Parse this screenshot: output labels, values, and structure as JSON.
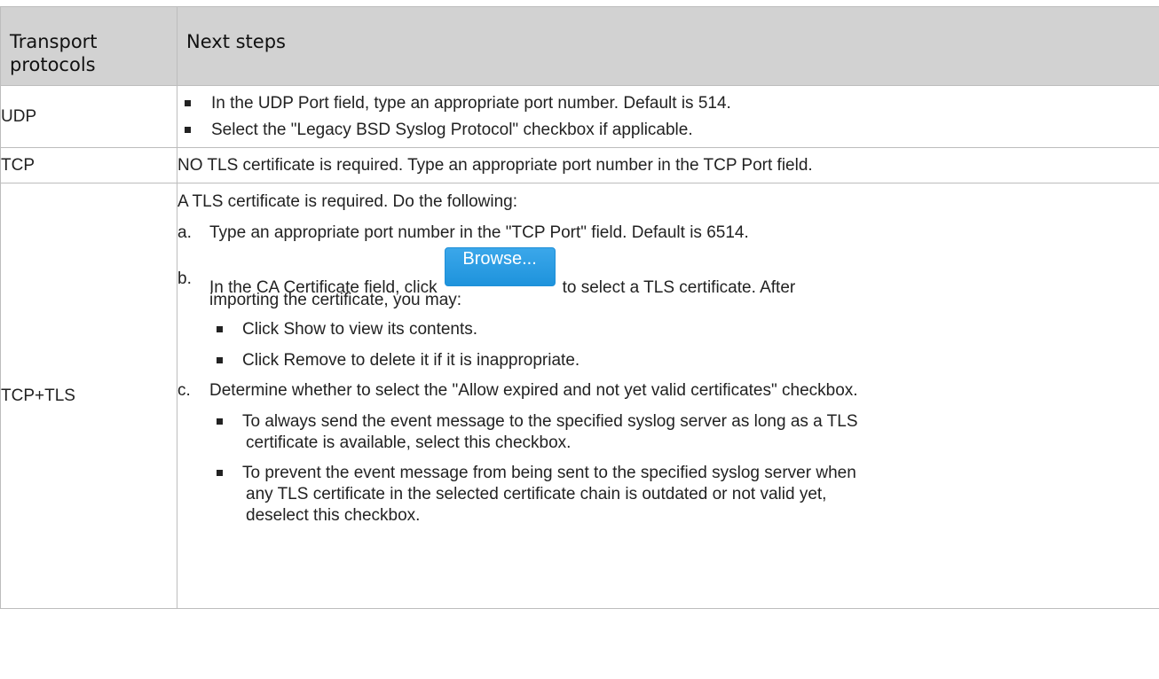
{
  "table": {
    "headers": {
      "col1_line1": "Transport",
      "col1_line2": "protocols",
      "col2": "Next steps"
    },
    "udp": {
      "protocol": "UDP",
      "bullets": [
        "In the UDP Port field, type an appropriate port number. Default is 514.",
        "Select the \"Legacy BSD Syslog Protocol\" checkbox if applicable."
      ]
    },
    "tcp": {
      "protocol": "TCP",
      "text": "NO TLS certificate is required. Type an appropriate port number in the TCP Port field."
    },
    "tcp_tls": {
      "protocol": "TCP+TLS",
      "intro": "A TLS certificate is required. Do the following:",
      "step_a_letter": "a.",
      "step_a": "Type an appropriate port number in the \"TCP Port\" field. Default is 6514.",
      "step_b_letter": "b.",
      "step_b_before": "In the CA Certificate field, click",
      "browse_label": "Browse...",
      "step_b_after": "to select a TLS certificate. After",
      "step_b_line2": "importing the certificate, you may:",
      "step_b_bullets": [
        "Click Show to view its contents.",
        "Click Remove to delete it if it is inappropriate."
      ],
      "step_c_letter": "c.",
      "step_c": "Determine whether to select the \"Allow expired and not yet valid certificates\" checkbox.",
      "step_c_bullet1_line1": "To always send the event message to the specified syslog server as long as a TLS",
      "step_c_bullet1_line2": "certificate is available, select this checkbox.",
      "step_c_bullet2_line1": "To prevent the event message from being sent to the specified syslog server when",
      "step_c_bullet2_line2": "any TLS certificate in the selected certificate chain is outdated or not valid yet,",
      "step_c_bullet2_line3": "deselect this checkbox."
    }
  }
}
